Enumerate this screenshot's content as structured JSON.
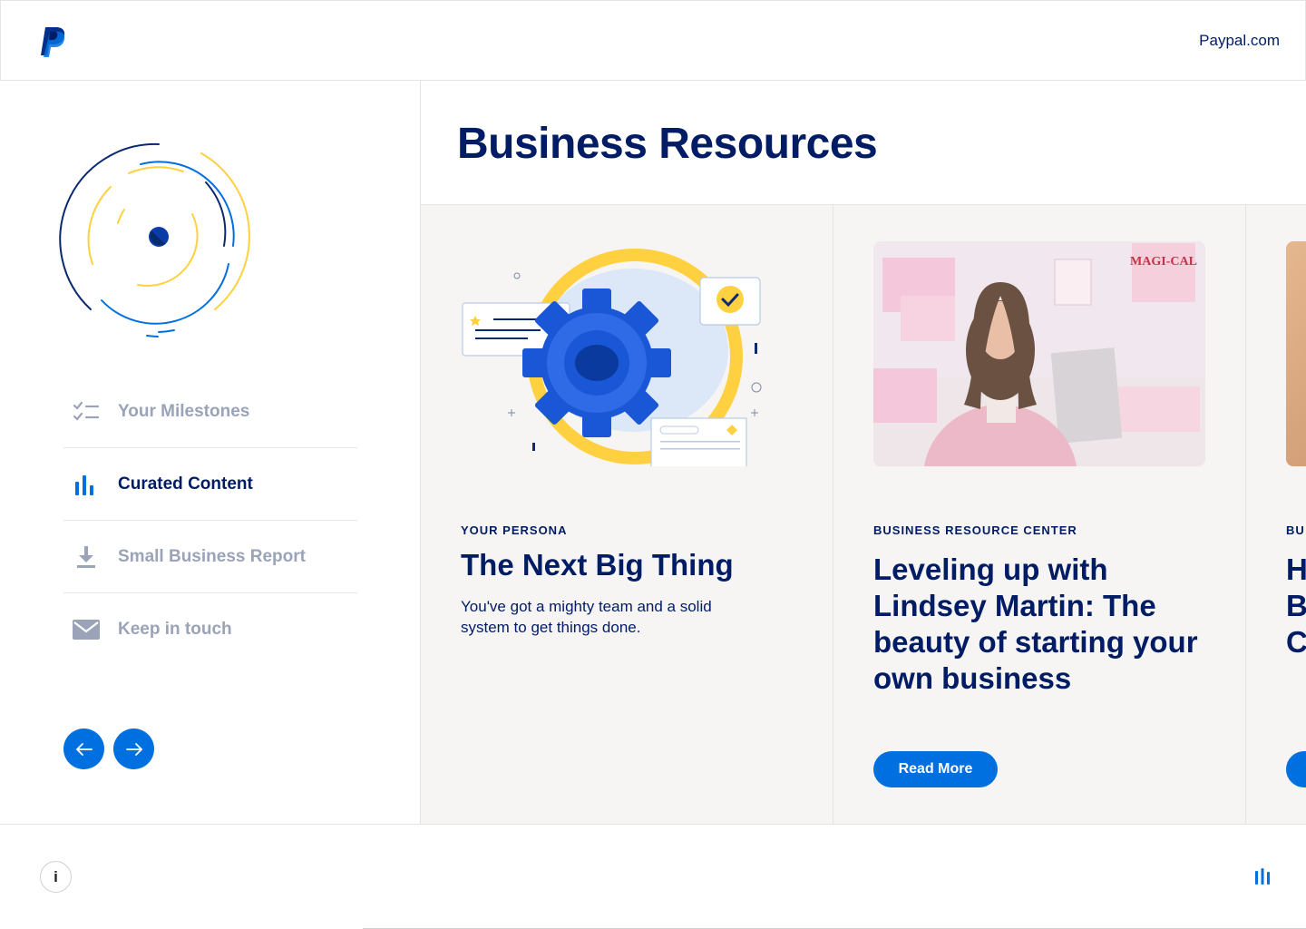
{
  "header": {
    "site_link": "Paypal.com",
    "logo_icon": "paypal-logo-icon"
  },
  "sidebar": {
    "nav": [
      {
        "label": "Your Milestones",
        "icon": "checklist-icon",
        "active": false
      },
      {
        "label": "Curated Content",
        "icon": "bar-chart-icon",
        "active": true
      },
      {
        "label": "Small Business Report",
        "icon": "download-icon",
        "active": false
      },
      {
        "label": "Keep in touch",
        "icon": "mail-icon",
        "active": false
      }
    ],
    "prev_icon": "arrow-left-icon",
    "next_icon": "arrow-right-icon"
  },
  "main": {
    "title": "Business Resources",
    "cards": [
      {
        "eyebrow": "YOUR PERSONA",
        "title": "The Next Big Thing",
        "description": "You've got a mighty team and a solid system to get things done."
      },
      {
        "eyebrow": "BUSINESS RESOURCE CENTER",
        "title": "Leveling up with Lindsey Martin: The beauty of starting your own business",
        "button": "Read More",
        "photo_sign": "MAGI-CAL"
      },
      {
        "eyebrow": "BU",
        "title_partial": "H B C"
      }
    ]
  },
  "footer": {
    "info_label": "i",
    "menu_icon": "equalizer-icon"
  },
  "colors": {
    "brand_navy": "#001c64",
    "brand_blue": "#0070e0",
    "accent_yellow": "#ffd140",
    "muted": "#9aa3b8"
  }
}
